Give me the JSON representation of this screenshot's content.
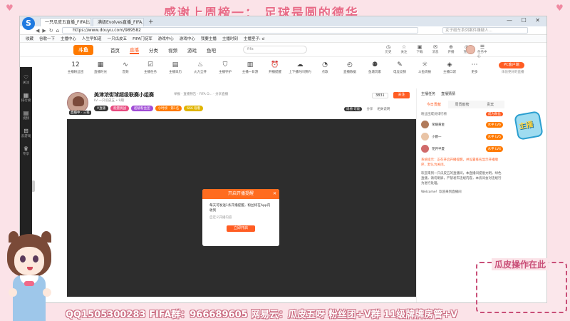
{
  "overlay": {
    "title": "感谢上周榜一：  足球是圆的德华",
    "bottom_text": "QQ1505300283  FIFA群：966689605  网易云：瓜皮五呀  粉丝团+V群  11级牌牌房管+V",
    "cam_label": "瓜皮操作在此"
  },
  "browser": {
    "logo": "S",
    "tabs": [
      "一只瓜皮五直播_FIFA比...",
      "满级Evolves直播_FIFA..."
    ],
    "new_tab": "+",
    "window_controls": "— ☐ ✕",
    "url": "https://www.douyu.com/989582",
    "search_placeholder": "女子砸车系列案件嫌疑人...",
    "bookmarks": [
      "收藏",
      "谷歌一下",
      "主播中心",
      "人生早知道",
      "一只瓜皮五",
      "FIFA门徒军",
      "游戏中心",
      "游戏中心",
      "我要主播",
      "主播时刻",
      "主播室子: d"
    ]
  },
  "douyu": {
    "logo": "斗鱼",
    "nav": [
      "首页",
      "直播",
      "分类",
      "视频",
      "游戏",
      "鱼吧"
    ],
    "search_placeholder": "fifa",
    "tools": [
      {
        "icon": "◷",
        "label": "历史"
      },
      {
        "icon": "☆",
        "label": "关注"
      },
      {
        "icon": "▣",
        "label": "下载"
      },
      {
        "icon": "✉",
        "label": "消息"
      },
      {
        "icon": "⊕",
        "label": "开播"
      },
      {
        "icon": "◎",
        "label": "充值"
      },
      {
        "icon": "☰",
        "label": "任务中心"
      }
    ]
  },
  "room_tools": [
    {
      "icon": "12",
      "label": "主播粉丝团"
    },
    {
      "icon": "▦",
      "label": "直播时光"
    },
    {
      "icon": "∿",
      "label": "音频"
    },
    {
      "icon": "☑",
      "label": "主播任务"
    },
    {
      "icon": "▤",
      "label": "主播日历"
    },
    {
      "icon": "♨",
      "label": "火力全开"
    },
    {
      "icon": "⛉",
      "label": "主播守护"
    },
    {
      "icon": "▥",
      "label": "主播一日游"
    },
    {
      "icon": "⏰",
      "label": "开播提醒"
    },
    {
      "icon": "☁",
      "label": "上下播时间预约"
    },
    {
      "icon": "◔",
      "label": "点歌"
    },
    {
      "icon": "◴",
      "label": "直播数据"
    },
    {
      "icon": "⚉",
      "label": "鱼塘玩家"
    },
    {
      "icon": "✎",
      "label": "电竞竞猜"
    },
    {
      "icon": "☼",
      "label": "斗鱼周报"
    },
    {
      "icon": "◈",
      "label": "主播口袋"
    },
    {
      "icon": "⋯",
      "label": "更多"
    }
  ],
  "pc_client": {
    "button": "PC客户端",
    "sub": "体验更好的直播"
  },
  "sidebar": [
    {
      "icon": "♡",
      "label": "关注"
    },
    {
      "icon": "▦",
      "label": "排行榜"
    },
    {
      "icon": "▤",
      "label": "视频"
    },
    {
      "icon": "⊞",
      "label": "云游戏"
    },
    {
      "icon": "♛",
      "label": "专享"
    }
  ],
  "room": {
    "title": "美津浓街球超级联赛小组赛",
    "meta": "举报 · 直播预告 · FIFA O... · 分享直播",
    "line2": "LV 一只瓜皮五 • 9期",
    "live_tag": "直播中 · 三排",
    "badges": [
      {
        "text": "V直播",
        "color": "#333333"
      },
      {
        "text": "能量挑战",
        "color": "#e84a7f"
      },
      {
        "text": "超级粉丝团",
        "color": "#a04cd6"
      },
      {
        "text": "小时榜 · 第1名",
        "color": "#ff7a00"
      },
      {
        "text": "666 观看",
        "color": "#e0b400"
      }
    ],
    "hot": "3831",
    "follow": "关注",
    "actions": [
      "周榜·可能",
      "分享",
      "相关说明"
    ]
  },
  "dialog": {
    "title": "开启开播提醒",
    "close": "✕",
    "message": "每天可发送1条开播提醒，粉丝将在App内收到",
    "check": "自定义开播内容",
    "button": "立即开启"
  },
  "right_panel": {
    "top": [
      "主播任务",
      "直播猜猜"
    ],
    "tabs": [
      "今日贡献",
      "周贡献榜",
      "贵宾"
    ],
    "sub_left": "粉丝团成员排行榜",
    "sub_btn": "成为粉丝",
    "fans": [
      {
        "name": "荣耀黄金",
        "badge": "水平 LV6",
        "color": "#b07a5a"
      },
      {
        "name": "小爵一",
        "badge": "水平 LV5",
        "color": "#e9c4a6"
      },
      {
        "name": "花开半夏",
        "badge": "水平 LV4",
        "color": "#d06a6a"
      }
    ],
    "chat": [
      "系统提示：正在开启开播提醒，并设置排名显示开播顺序，默认为关闭。",
      "欢迎来到一只瓜皮五的直播间，本直播间提倡文明，绿色直播，请勿刷屏，严禁发布违规内容，本房间会对违规行为进行处理。",
      "Welcome！欢迎来到直播间"
    ]
  },
  "mascot": {
    "text": "主播"
  }
}
